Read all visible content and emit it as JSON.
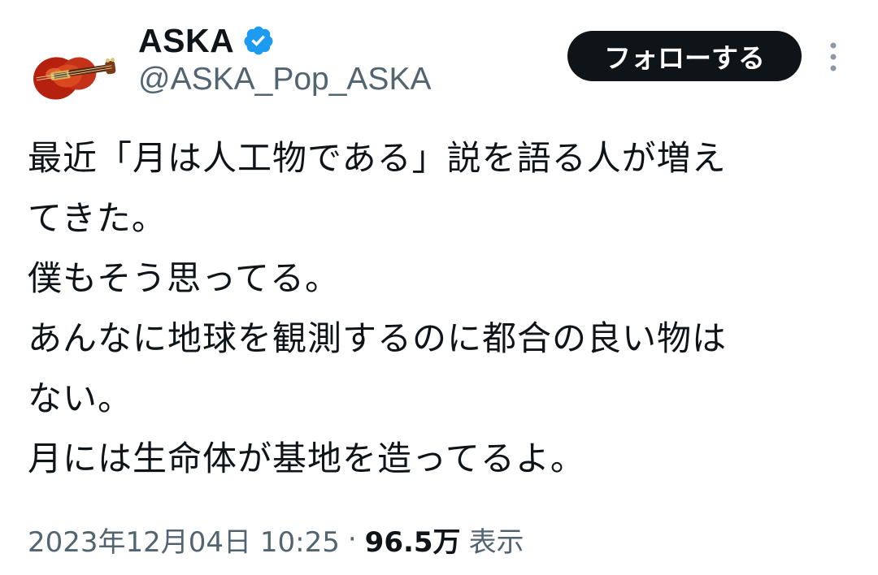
{
  "author": {
    "display_name": "ASKA",
    "handle": "@ASKA_Pop_ASKA",
    "avatar_icon": "violin-bass-guitar-icon",
    "verified_icon": "verified-badge-icon",
    "verified_color": "#1d9bf0"
  },
  "actions": {
    "follow_label": "フォローする",
    "more_icon": "more-options-icon"
  },
  "tweet": {
    "lines": [
      "最近「月は人工物である」説を語る人が増え",
      "てきた。",
      "僕もそう思ってる。",
      "あんなに地球を観測するのに都合の良い物は",
      "ない。",
      "月には生命体が基地を造ってるよ。"
    ]
  },
  "meta": {
    "timestamp": "2023年12月04日 10:25",
    "separator": "·",
    "views_count": "96.5万",
    "views_label": "表示"
  }
}
